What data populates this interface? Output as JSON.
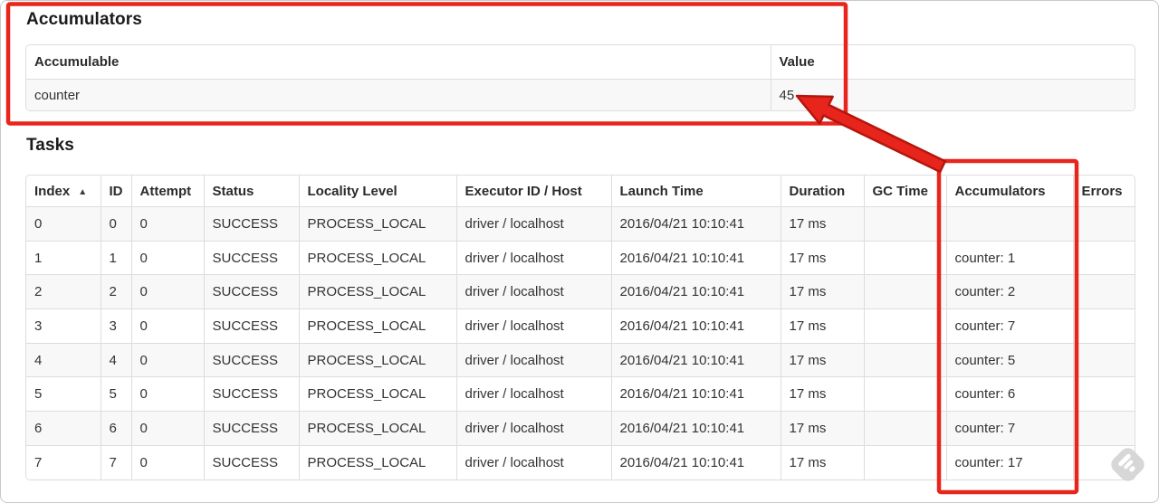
{
  "accumulators": {
    "heading": "Accumulators",
    "table": {
      "headers": [
        "Accumulable",
        "Value"
      ],
      "rows": [
        [
          "counter",
          "45"
        ]
      ]
    }
  },
  "tasks": {
    "heading": "Tasks",
    "table": {
      "headers": [
        "Index",
        "ID",
        "Attempt",
        "Status",
        "Locality Level",
        "Executor ID / Host",
        "Launch Time",
        "Duration",
        "GC Time",
        "Accumulators",
        "Errors"
      ],
      "sort_column": 0,
      "sort_icon": "▲",
      "rows": [
        [
          "0",
          "0",
          "0",
          "SUCCESS",
          "PROCESS_LOCAL",
          "driver / localhost",
          "2016/04/21 10:10:41",
          "17 ms",
          "",
          "",
          ""
        ],
        [
          "1",
          "1",
          "0",
          "SUCCESS",
          "PROCESS_LOCAL",
          "driver / localhost",
          "2016/04/21 10:10:41",
          "17 ms",
          "",
          "counter: 1",
          ""
        ],
        [
          "2",
          "2",
          "0",
          "SUCCESS",
          "PROCESS_LOCAL",
          "driver / localhost",
          "2016/04/21 10:10:41",
          "17 ms",
          "",
          "counter: 2",
          ""
        ],
        [
          "3",
          "3",
          "0",
          "SUCCESS",
          "PROCESS_LOCAL",
          "driver / localhost",
          "2016/04/21 10:10:41",
          "17 ms",
          "",
          "counter: 7",
          ""
        ],
        [
          "4",
          "4",
          "0",
          "SUCCESS",
          "PROCESS_LOCAL",
          "driver / localhost",
          "2016/04/21 10:10:41",
          "17 ms",
          "",
          "counter: 5",
          ""
        ],
        [
          "5",
          "5",
          "0",
          "SUCCESS",
          "PROCESS_LOCAL",
          "driver / localhost",
          "2016/04/21 10:10:41",
          "17 ms",
          "",
          "counter: 6",
          ""
        ],
        [
          "6",
          "6",
          "0",
          "SUCCESS",
          "PROCESS_LOCAL",
          "driver / localhost",
          "2016/04/21 10:10:41",
          "17 ms",
          "",
          "counter: 7",
          ""
        ],
        [
          "7",
          "7",
          "0",
          "SUCCESS",
          "PROCESS_LOCAL",
          "driver / localhost",
          "2016/04/21 10:10:41",
          "17 ms",
          "",
          "counter: 17",
          ""
        ]
      ]
    }
  },
  "annotations": {
    "color": "#e8251c",
    "outline_color": "#b5150c",
    "highlighted_value": "45",
    "highlighted_column": "Accumulators"
  },
  "icons": {
    "sort": "sort-ascending-icon",
    "watermark": "feedly-logo-icon"
  }
}
